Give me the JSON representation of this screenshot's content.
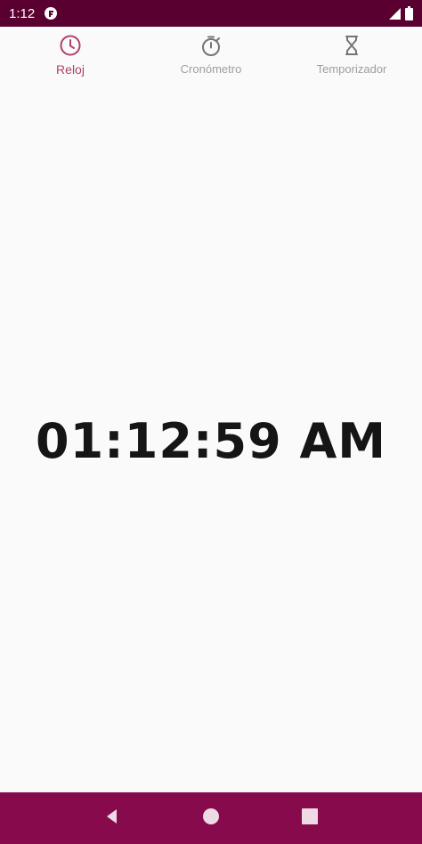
{
  "status_bar": {
    "time": "1:12",
    "icons": [
      "notification-app-icon",
      "signal-icon",
      "battery-icon"
    ]
  },
  "tabs": [
    {
      "label": "Reloj",
      "icon": "clock-icon",
      "active": true
    },
    {
      "label": "Cronómetro",
      "icon": "stopwatch-icon",
      "active": false
    },
    {
      "label": "Temporizador",
      "icon": "hourglass-icon",
      "active": false
    }
  ],
  "clock": {
    "time": "01:12:59 AM"
  },
  "nav_bar": {
    "buttons": [
      "back-icon",
      "home-icon",
      "recents-icon"
    ]
  },
  "colors": {
    "status_bar": "#5a0030",
    "nav_bar": "#870a4c",
    "accent": "#b0406e",
    "inactive": "#9e9e9e",
    "background": "#fafafa"
  }
}
